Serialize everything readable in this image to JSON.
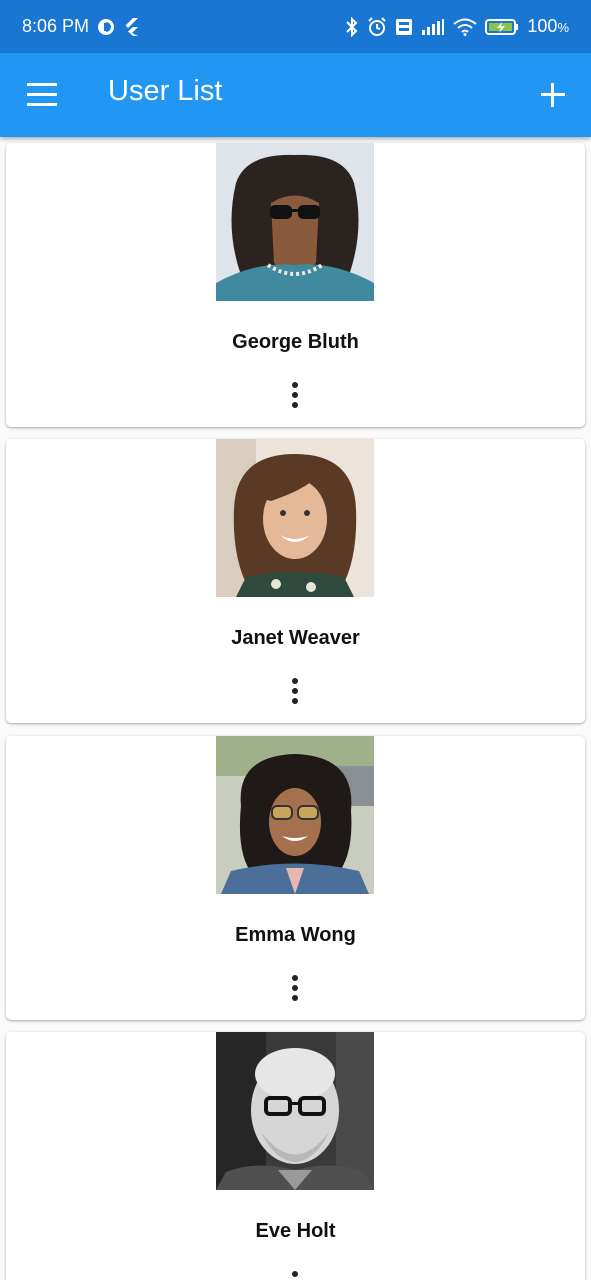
{
  "status_bar": {
    "time": "8:06 PM",
    "battery": "100",
    "battery_unit": "%"
  },
  "app_bar": {
    "title": "User List",
    "menu_icon": "hamburger-menu-icon",
    "add_icon": "plus-icon"
  },
  "users": [
    {
      "name": "George Bluth"
    },
    {
      "name": "Janet Weaver"
    },
    {
      "name": "Emma Wong"
    },
    {
      "name": "Eve Holt"
    }
  ],
  "colors": {
    "status_bar": "#1976d2",
    "app_bar": "#2196f3",
    "background": "#fafafa",
    "card": "#ffffff"
  }
}
